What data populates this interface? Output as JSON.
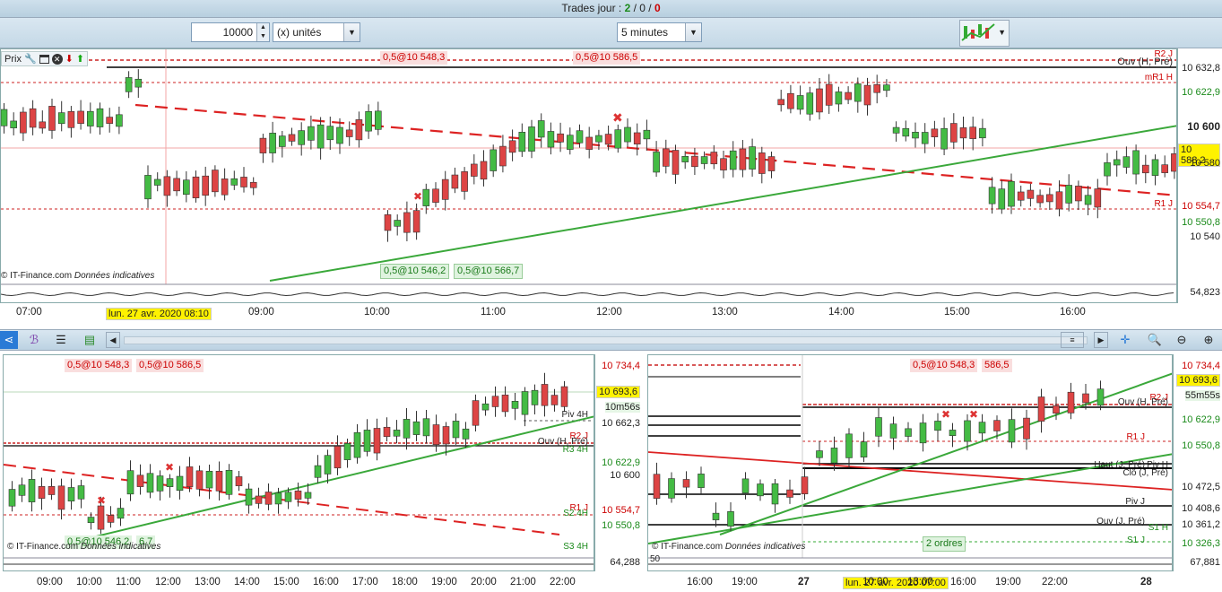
{
  "topbar": {
    "label": "Trades jour : ",
    "wins": "2",
    "sep1": " / ",
    "flat": "0",
    "sep2": " / ",
    "losses": "0"
  },
  "toolbar": {
    "quantity": "10000",
    "unit_select": "(x) unités",
    "period_select": "5 minutes"
  },
  "main_chart": {
    "prix_label": "Prix",
    "orders_top": [
      "0,5@10 548,3",
      "0,5@10 586,5"
    ],
    "orders_bottom": [
      "0,5@10 546,2",
      "0,5@10 566,7"
    ],
    "levels": [
      "R2 J",
      "Ouv (H, Pré)",
      "mR1 H",
      "R1 J"
    ],
    "y_labels": [
      "10 632,8",
      "10 622,9",
      "10 600",
      "10 588,2",
      "10 580",
      "10 554,7",
      "10 550,8",
      "10 540"
    ],
    "current_price": "10 588,2",
    "copyright": "© IT-Finance.com",
    "data_note": "Données indicatives",
    "indicator_value": "54,823",
    "time_labels": [
      "07:00",
      "09:00",
      "10:00",
      "11:00",
      "12:00",
      "13:00",
      "14:00",
      "15:00",
      "16:00"
    ],
    "cursor_date": "lun. 27 avr. 2020 08:10"
  },
  "chart_data": [
    {
      "type": "candlestick",
      "title": "",
      "x": [
        "07:00",
        "09:00",
        "10:00",
        "11:00",
        "12:00",
        "13:00",
        "14:00",
        "15:00",
        "16:00"
      ],
      "ylim": [
        10530,
        10640
      ],
      "series": [
        {
          "values": [
            10600,
            10632,
            10580,
            10560,
            10548,
            10570,
            10592,
            10605,
            10585,
            10580,
            10600,
            10618,
            10610,
            10592,
            10560,
            10570,
            10590,
            10600
          ]
        }
      ]
    }
  ],
  "left_chart": {
    "orders_top": [
      "0,5@10 548,3",
      "0,5@10 586,5"
    ],
    "orders_bottom": [
      "0,5@10 546,2",
      "6,7"
    ],
    "levels": [
      "Piv 4H",
      "R2 J",
      "Ouv (H, Pré)",
      "R3 4H",
      "R1 J",
      "S2 4H",
      "S3 4H"
    ],
    "y_labels": [
      "10 734,4",
      "10 693,6",
      "10m56s",
      "10 662,3",
      "10 622,9",
      "10 600",
      "10 554,7",
      "10 550,8"
    ],
    "current_price": "10 693,6",
    "timer": "10m56s",
    "copyright": "© IT-Finance.com",
    "data_note": "Données indicatives",
    "indicator_value": "64,288",
    "time_labels": [
      "09:00",
      "10:00",
      "11:00",
      "12:00",
      "13:00",
      "14:00",
      "15:00",
      "16:00",
      "17:00",
      "18:00",
      "19:00",
      "20:00",
      "21:00",
      "22:00"
    ]
  },
  "right_chart": {
    "orders_top": [
      "0,5@10 548,3",
      "586,5"
    ],
    "levels": [
      "R2 J",
      "Ouv (H, Pré)",
      "R1 J",
      "Haut (J, Pré)",
      "Piv H",
      "Clô (J, Pré)",
      "Piv J",
      "Ouv (J, Pré)",
      "S1 H",
      "S1 J"
    ],
    "y_labels": [
      "10 734,4",
      "10 693,6",
      "55m55s",
      "10 622,9",
      "10 550,8",
      "10 472,5",
      "10 408,6",
      "10 361,2",
      "10 326,3"
    ],
    "current_price": "10 693,6",
    "timer": "55m55s",
    "copyright": "© IT-Finance.com",
    "data_note": "Données indicatives",
    "orders_badge": "2 ordres",
    "indicator_value": "67,881",
    "indicator_scale": "50",
    "time_labels": [
      "16:00",
      "19:00",
      "27",
      "10:00",
      "13:00",
      "16:00",
      "19:00",
      "22:00",
      "28"
    ],
    "cursor_date": "lun. 27 avr. 2020 07:00"
  },
  "colors": {
    "bull": "#44bb44",
    "bear": "#dd4444",
    "trend_green": "#3aa83a",
    "trend_red": "#dd2222",
    "level_red": "#cc2222"
  }
}
